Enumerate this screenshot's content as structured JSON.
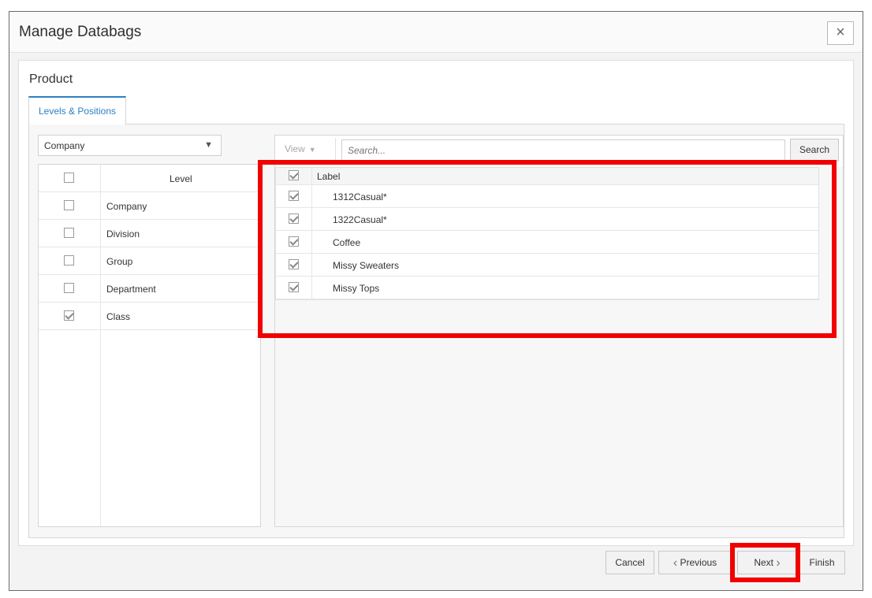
{
  "dialog": {
    "title": "Manage Databags",
    "close_label": "×"
  },
  "section": {
    "title": "Product",
    "tab_label": "Levels & Positions"
  },
  "hierarchy_select": {
    "value": "Company",
    "caret": "▼"
  },
  "levels_table": {
    "header": "Level",
    "header_checked": false,
    "rows": [
      {
        "label": "Company",
        "checked": false
      },
      {
        "label": "Division",
        "checked": false
      },
      {
        "label": "Group",
        "checked": false
      },
      {
        "label": "Department",
        "checked": false
      },
      {
        "label": "Class",
        "checked": true
      }
    ]
  },
  "positions_toolbar": {
    "view_label": "View",
    "view_caret": "▼",
    "search_placeholder": "Search...",
    "search_button": "Search"
  },
  "positions_table": {
    "header": "Label",
    "header_checked": true,
    "rows": [
      {
        "label": "1312Casual*",
        "checked": true
      },
      {
        "label": "1322Casual*",
        "checked": true
      },
      {
        "label": "Coffee",
        "checked": true
      },
      {
        "label": "Missy Sweaters",
        "checked": true
      },
      {
        "label": "Missy Tops",
        "checked": true
      }
    ]
  },
  "footer": {
    "cancel": "Cancel",
    "previous": "Previous",
    "previous_icon": "‹",
    "next": "Next",
    "next_icon": "›",
    "finish": "Finish"
  },
  "colors": {
    "highlight": "#f20000",
    "accent": "#2d7fc2"
  }
}
